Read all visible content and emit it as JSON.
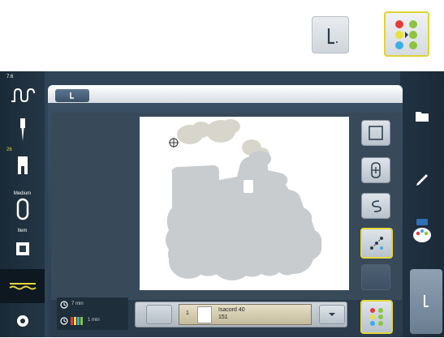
{
  "left_sidebar": {
    "speed_value": "7.6",
    "presser_foot_label": "26",
    "hoop_label": "Medium",
    "stabilizer_label": "Item"
  },
  "bottom_info": {
    "total_time": "7 min",
    "color_time": "1 min"
  },
  "color_info": {
    "index": "1",
    "thread_name": "Isacord 40",
    "thread_number": "151"
  },
  "icons": {
    "top_left": "needle-stitch-icon",
    "top_right": "color-sequence-icon",
    "thread_tension": "thread-tension-icon",
    "needle": "needle-icon",
    "presser_foot": "presser-foot-icon",
    "hoop": "hoop-icon",
    "stabilizer": "stabilizer-icon",
    "bobbin_lines": "bobbin-lines-icon",
    "settings": "gear-icon",
    "folder": "folder-icon",
    "edit": "pencil-icon",
    "color_palette": "color-palette-icon",
    "stitch_start": "stitch-start-icon",
    "frame_check": "frame-check-icon",
    "hoop_center": "hoop-center-icon",
    "needle_move": "needle-move-icon",
    "stitch_order": "stitch-order-icon",
    "multicolor": "multicolor-icon",
    "chevron_down": "chevron-down-icon",
    "clock": "clock-icon"
  },
  "colors": {
    "accent_yellow": "#e4d83a",
    "panel_bg": "#2b3e51",
    "canvas_bg": "#ffffff",
    "design_gray": "#c9ccce"
  }
}
